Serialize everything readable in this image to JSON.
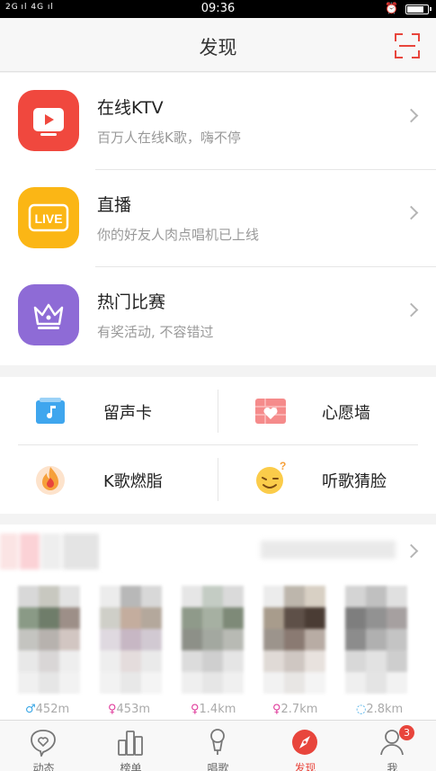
{
  "status_bar": {
    "signal": "2G ıl 4G ıl",
    "time": "09:36"
  },
  "header": {
    "title": "发现"
  },
  "cards": [
    {
      "title": "在线KTV",
      "subtitle": "百万人在线K歌，嗨不停",
      "color": "#f0483e",
      "icon": "ktv-play-icon"
    },
    {
      "title": "直播",
      "subtitle": "你的好友人肉点唱机已上线",
      "color": "#fbb615",
      "icon": "live-icon",
      "badge_text": "LIVE"
    },
    {
      "title": "热门比赛",
      "subtitle": "有奖活动, 不容错过",
      "color": "#8e6bd6",
      "icon": "crown-icon"
    }
  ],
  "grid": [
    {
      "label": "留声卡",
      "icon": "music-card-icon"
    },
    {
      "label": "心愿墙",
      "icon": "heart-wall-icon"
    },
    {
      "label": "K歌燃脂",
      "icon": "flame-icon"
    },
    {
      "label": "听歌猜脸",
      "icon": "wink-face-icon"
    }
  ],
  "nearby": {
    "distances": [
      {
        "gender": "♂",
        "value": "452m"
      },
      {
        "gender": "♀",
        "value": "453m"
      },
      {
        "gender": "♀",
        "value": "1.4km"
      },
      {
        "gender": "♀",
        "value": "2.7km"
      },
      {
        "gender": "◌",
        "value": "2.8km"
      }
    ]
  },
  "tabbar": {
    "tabs": [
      {
        "label": "动态",
        "icon": "heart-chat-icon"
      },
      {
        "label": "榜单",
        "icon": "ranking-icon"
      },
      {
        "label": "唱歌",
        "icon": "microphone-icon"
      },
      {
        "label": "发现",
        "icon": "compass-icon",
        "active": true
      },
      {
        "label": "我",
        "icon": "person-icon",
        "badge": "3"
      }
    ]
  },
  "colors": {
    "accent": "#e8453c",
    "male": "#3aa7e6",
    "female": "#e03c9c"
  }
}
